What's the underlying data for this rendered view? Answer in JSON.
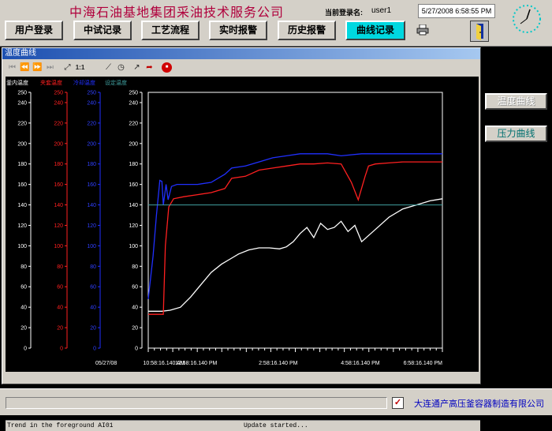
{
  "header": {
    "company": "中海石油基地集团采油技术服务公司",
    "user_caption": "当前登录名:",
    "user_name": "user1",
    "datetime": "5/27/2008 6:58:55 PM"
  },
  "nav": [
    {
      "label": "用户登录",
      "active": false
    },
    {
      "label": "中试记录",
      "active": false
    },
    {
      "label": "工艺流程",
      "active": false
    },
    {
      "label": "实时报警",
      "active": false
    },
    {
      "label": "历史报警",
      "active": false
    },
    {
      "label": "曲线记录",
      "active": true
    }
  ],
  "trend_window": {
    "title": "温度曲线",
    "toolbar_zoom_label": "1:1",
    "status_left": "Trend in the foreground AI01",
    "status_right": "Update started..."
  },
  "side_buttons": [
    {
      "label": "温度曲线",
      "enabled": false
    },
    {
      "label": "压力曲线",
      "enabled": true
    }
  ],
  "footer": {
    "checkbox_mark": "✓",
    "maker": "大连通产高压釜容器制造有限公司"
  },
  "colors": {
    "active_nav": "#00d8e0",
    "kettle_series": "#ffffff",
    "jacket_series": "#ff2020",
    "coolant_series": "#2030ff",
    "setpoint_series": "#40a0a0"
  },
  "chart_data": {
    "type": "line",
    "date_label": "05/27/08",
    "x_ticks": [
      "10:58:16.140 AM",
      "12:58:16.140 PM",
      "2:58:16.140 PM",
      "4:58:16.140 PM",
      "6:58:16.140 PM"
    ],
    "y_ticks": [
      0,
      20,
      40,
      60,
      80,
      100,
      120,
      140,
      160,
      180,
      200,
      220,
      240,
      250
    ],
    "ylim": [
      0,
      250
    ],
    "xlim": [
      "11:48 AM",
      "6:58 PM"
    ],
    "grid": false,
    "series": [
      {
        "name": "釜内温度",
        "color": "#ffffff",
        "x": [
          "11:48 AM",
          "12:00 PM",
          "12:08 PM",
          "12:20 PM",
          "12:35 PM",
          "12:50 PM",
          "1:05 PM",
          "1:20 PM",
          "1:35 PM",
          "1:50 PM",
          "2:00 PM",
          "2:15 PM",
          "2:30 PM",
          "2:45 PM",
          "3:00 PM",
          "3:10 PM",
          "3:20 PM",
          "3:30 PM",
          "3:40 PM",
          "3:50 PM",
          "4:00 PM",
          "4:10 PM",
          "4:20 PM",
          "4:30 PM",
          "4:40 PM",
          "4:50 PM",
          "5:00 PM",
          "5:20 PM",
          "5:40 PM",
          "6:00 PM",
          "6:20 PM",
          "6:40 PM",
          "6:58 PM"
        ],
        "values": [
          36,
          36,
          36,
          37,
          40,
          50,
          62,
          74,
          82,
          88,
          92,
          96,
          98,
          98,
          97,
          99,
          104,
          112,
          118,
          108,
          122,
          116,
          118,
          124,
          114,
          120,
          104,
          116,
          128,
          136,
          140,
          144,
          146
        ]
      },
      {
        "name": "夹套温度",
        "color": "#ff2020",
        "x": [
          "11:48 AM",
          "12:00 PM",
          "12:10 PM",
          "12:13 PM",
          "12:18 PM",
          "12:25 PM",
          "12:40 PM",
          "1:00 PM",
          "1:20 PM",
          "1:40 PM",
          "1:50 PM",
          "2:10 PM",
          "2:30 PM",
          "2:50 PM",
          "3:10 PM",
          "3:30 PM",
          "3:50 PM",
          "4:10 PM",
          "4:30 PM",
          "4:45 PM",
          "4:55 PM",
          "5:05 PM",
          "5:10 PM",
          "5:20 PM",
          "5:40 PM",
          "6:00 PM",
          "6:20 PM",
          "6:40 PM",
          "6:58 PM"
        ],
        "values": [
          33,
          33,
          33,
          100,
          138,
          146,
          148,
          150,
          152,
          156,
          166,
          168,
          174,
          176,
          178,
          180,
          180,
          181,
          180,
          162,
          145,
          168,
          178,
          180,
          181,
          182,
          182,
          182,
          182
        ]
      },
      {
        "name": "冷却温度",
        "color": "#2030ff",
        "x": [
          "11:48 AM",
          "11:55 AM",
          "12:00 PM",
          "12:05 PM",
          "12:08 PM",
          "12:10 PM",
          "12:14 PM",
          "12:17 PM",
          "12:22 PM",
          "12:30 PM",
          "1:00 PM",
          "1:20 PM",
          "1:40 PM",
          "1:50 PM",
          "2:10 PM",
          "2:30 PM",
          "2:50 PM",
          "3:10 PM",
          "3:30 PM",
          "3:50 PM",
          "4:10 PM",
          "4:30 PM",
          "5:00 PM",
          "5:30 PM",
          "6:00 PM",
          "6:30 PM",
          "6:58 PM"
        ],
        "values": [
          48,
          90,
          130,
          164,
          163,
          140,
          160,
          145,
          158,
          160,
          160,
          162,
          170,
          176,
          178,
          182,
          186,
          188,
          190,
          190,
          190,
          188,
          190,
          190,
          190,
          190,
          190
        ]
      },
      {
        "name": "设定温度",
        "color": "#40a0a0",
        "x": [
          "11:48 AM",
          "6:58 PM"
        ],
        "values": [
          140,
          140
        ]
      }
    ]
  }
}
